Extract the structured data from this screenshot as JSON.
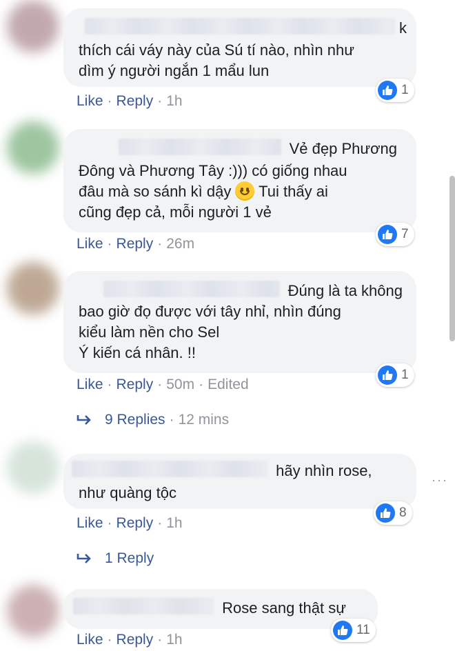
{
  "ui": {
    "like": "Like",
    "reply": "Reply",
    "sep": "·",
    "edited": "Edited",
    "more": "···"
  },
  "colors": {
    "link": "#385898",
    "meta": "#90949c",
    "bubble": "#f2f3f5",
    "like_badge": "#2078f4"
  },
  "comments": [
    {
      "text_lead": "k",
      "text": "thích cái váy này của Sú tí nào, nhìn như\ndìm ý người ngắn 1 mẩu lun",
      "time": "1h",
      "reactions": "1"
    },
    {
      "text_lead": "Vẻ đẹp Phương",
      "text_pre": "Đông và Phương Tây :))) có giống nhau\nđâu mà so sánh kì dậy ",
      "emoji": "smiley-emoji",
      "text_post": " Tui thấy ai\ncũng đẹp cả, mỗi người 1 vẻ",
      "time": "26m",
      "reactions": "7"
    },
    {
      "text_lead": "Đúng là ta không",
      "text": "bao giờ đọ được với tây nhỉ, nhìn đúng\nkiểu làm nền cho Sel\nÝ kiến cá nhân. !!",
      "time": "50m",
      "reactions": "1",
      "replies": {
        "label": "9 Replies",
        "time": "12 mins"
      }
    },
    {
      "text_lead": "hãy nhìn rose,",
      "text": "như quàng tộc",
      "time": "1h",
      "reactions": "8",
      "replies": {
        "label": "1 Reply"
      }
    },
    {
      "text_lead": "Rose sang thật sự",
      "time": "1h",
      "reactions": "11"
    }
  ]
}
